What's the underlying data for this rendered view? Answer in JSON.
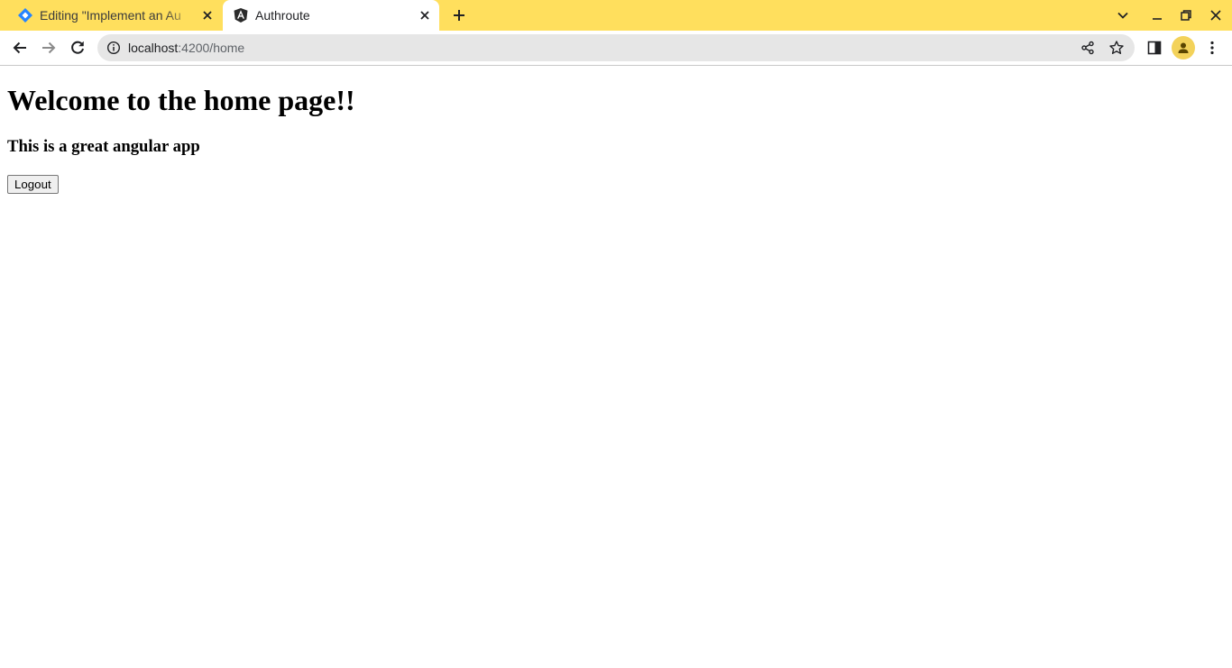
{
  "browser": {
    "tabs": [
      {
        "title": "Editing \"Implement an Au",
        "favicon": "jira-diamond-icon",
        "active": false
      },
      {
        "title": "Authroute",
        "favicon": "angular-icon",
        "active": true
      }
    ],
    "address": {
      "host": "localhost",
      "path": ":4200/home"
    },
    "colors": {
      "tabstrip": "#ffdf5d",
      "omnibox": "#e6e6e6",
      "avatar": "#f3d25a"
    }
  },
  "page": {
    "heading": "Welcome to the home page!!",
    "subheading": "This is a great angular app",
    "logout_label": "Logout"
  }
}
